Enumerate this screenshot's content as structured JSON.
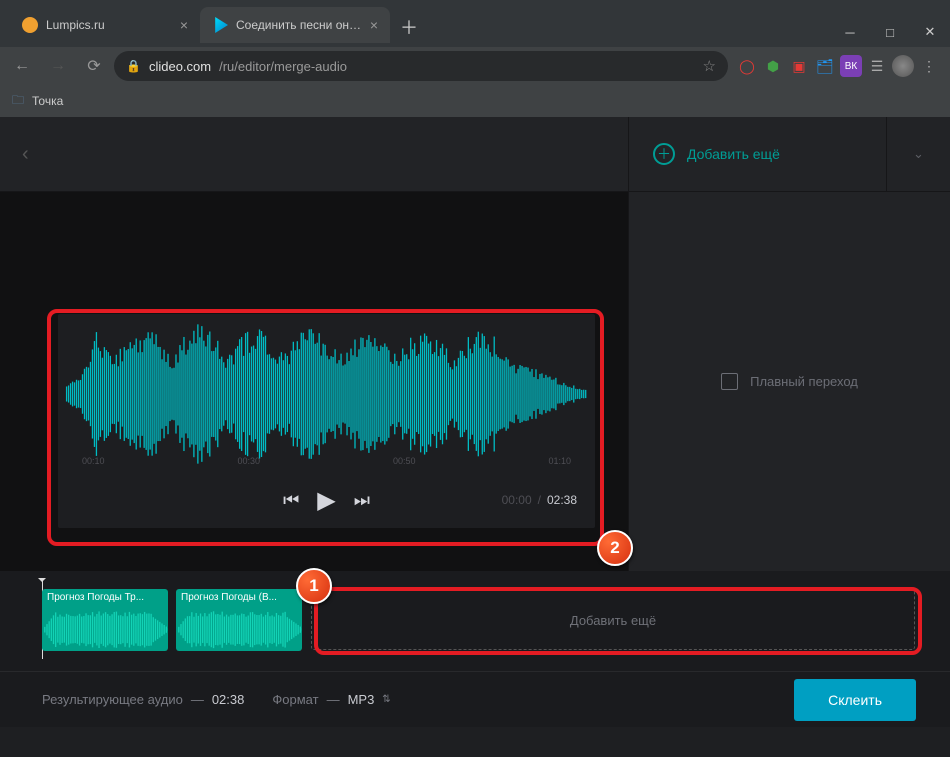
{
  "browser": {
    "tabs": [
      {
        "title": "Lumpics.ru",
        "active": false,
        "favColor": "#f0a030"
      },
      {
        "title": "Соединить песни онлайн — Со",
        "active": true,
        "favColor": "#00b8d4"
      }
    ],
    "url_domain": "clideo.com",
    "url_path": "/ru/editor/merge-audio",
    "bookmark": "Точка"
  },
  "header": {
    "add_more": "Добавить ещё"
  },
  "sidebar": {
    "crossfade": "Плавный переход"
  },
  "player": {
    "time_current": "00:00",
    "time_total": "02:38",
    "ruler": [
      "00:10",
      "00:30",
      "00:50",
      "01:10"
    ]
  },
  "timeline": {
    "clips": [
      {
        "label": "Прогноз Погоды Тр..."
      },
      {
        "label": "Прогноз Погоды (В..."
      }
    ],
    "dropzone": "Добавить ещё"
  },
  "bottombar": {
    "result_label": "Результирующее аудио",
    "result_dur": "02:38",
    "format_label": "Формат",
    "format_value": "MP3",
    "merge": "Склеить"
  },
  "annotations": {
    "badge1": "1",
    "badge2": "2"
  }
}
